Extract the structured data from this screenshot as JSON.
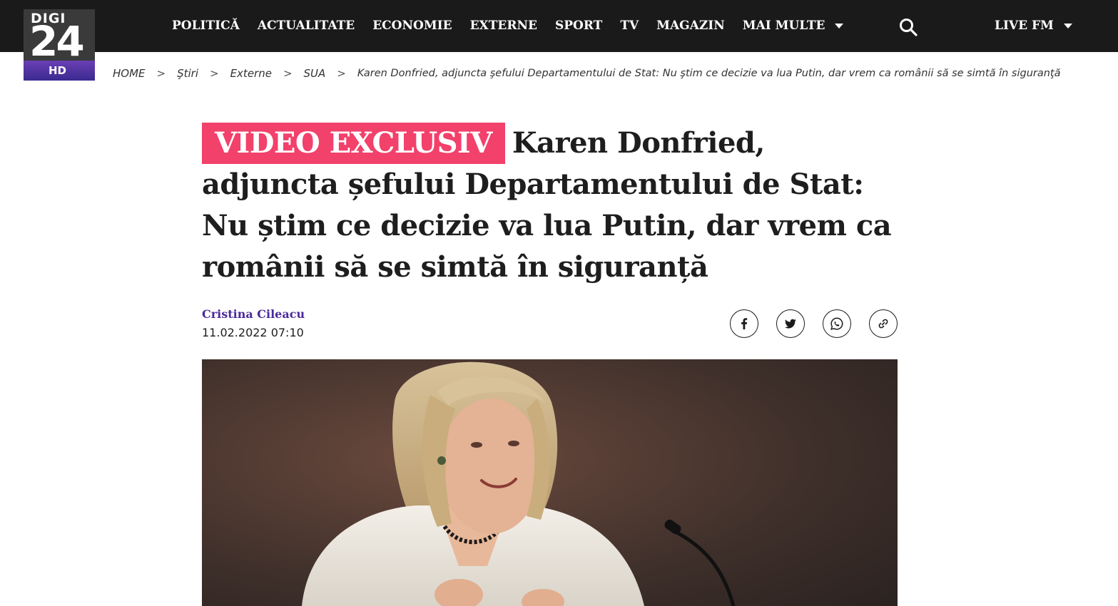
{
  "header": {
    "logo": {
      "top_text": "DIGI",
      "number": "24",
      "badge": "HD"
    },
    "nav": [
      {
        "label": "POLITICĂ"
      },
      {
        "label": "ACTUALITATE"
      },
      {
        "label": "ECONOMIE"
      },
      {
        "label": "EXTERNE"
      },
      {
        "label": "SPORT"
      },
      {
        "label": "TV"
      },
      {
        "label": "MAGAZIN"
      },
      {
        "label": "MAI MULTE"
      }
    ],
    "live_label": "LIVE FM",
    "search_icon": "search-icon"
  },
  "breadcrumb": {
    "items": [
      "HOME",
      "Ştiri",
      "Externe",
      "SUA"
    ],
    "separator": ">",
    "current": "Karen Donfried, adjuncta şefului Departamentului de Stat: Nu ştim ce decizie va lua Putin, dar vrem ca românii să se simtă în siguranţă"
  },
  "article": {
    "tag": "VIDEO EXCLUSIV",
    "title": "Karen Donfried, adjuncta șefului Departamentului de Stat: Nu știm ce decizie va lua Putin, dar vrem ca românii să se simtă în siguranță",
    "author": "Cristina Cileacu",
    "date": "11.02.2022 07:10"
  },
  "share": [
    {
      "icon": "facebook-icon"
    },
    {
      "icon": "twitter-icon"
    },
    {
      "icon": "whatsapp-icon"
    },
    {
      "icon": "link-icon"
    }
  ],
  "colors": {
    "topbar": "#1a1a1a",
    "tag_background": "#f2416b",
    "author": "#4a2a9a",
    "logo_badge": "#5a35a8"
  }
}
